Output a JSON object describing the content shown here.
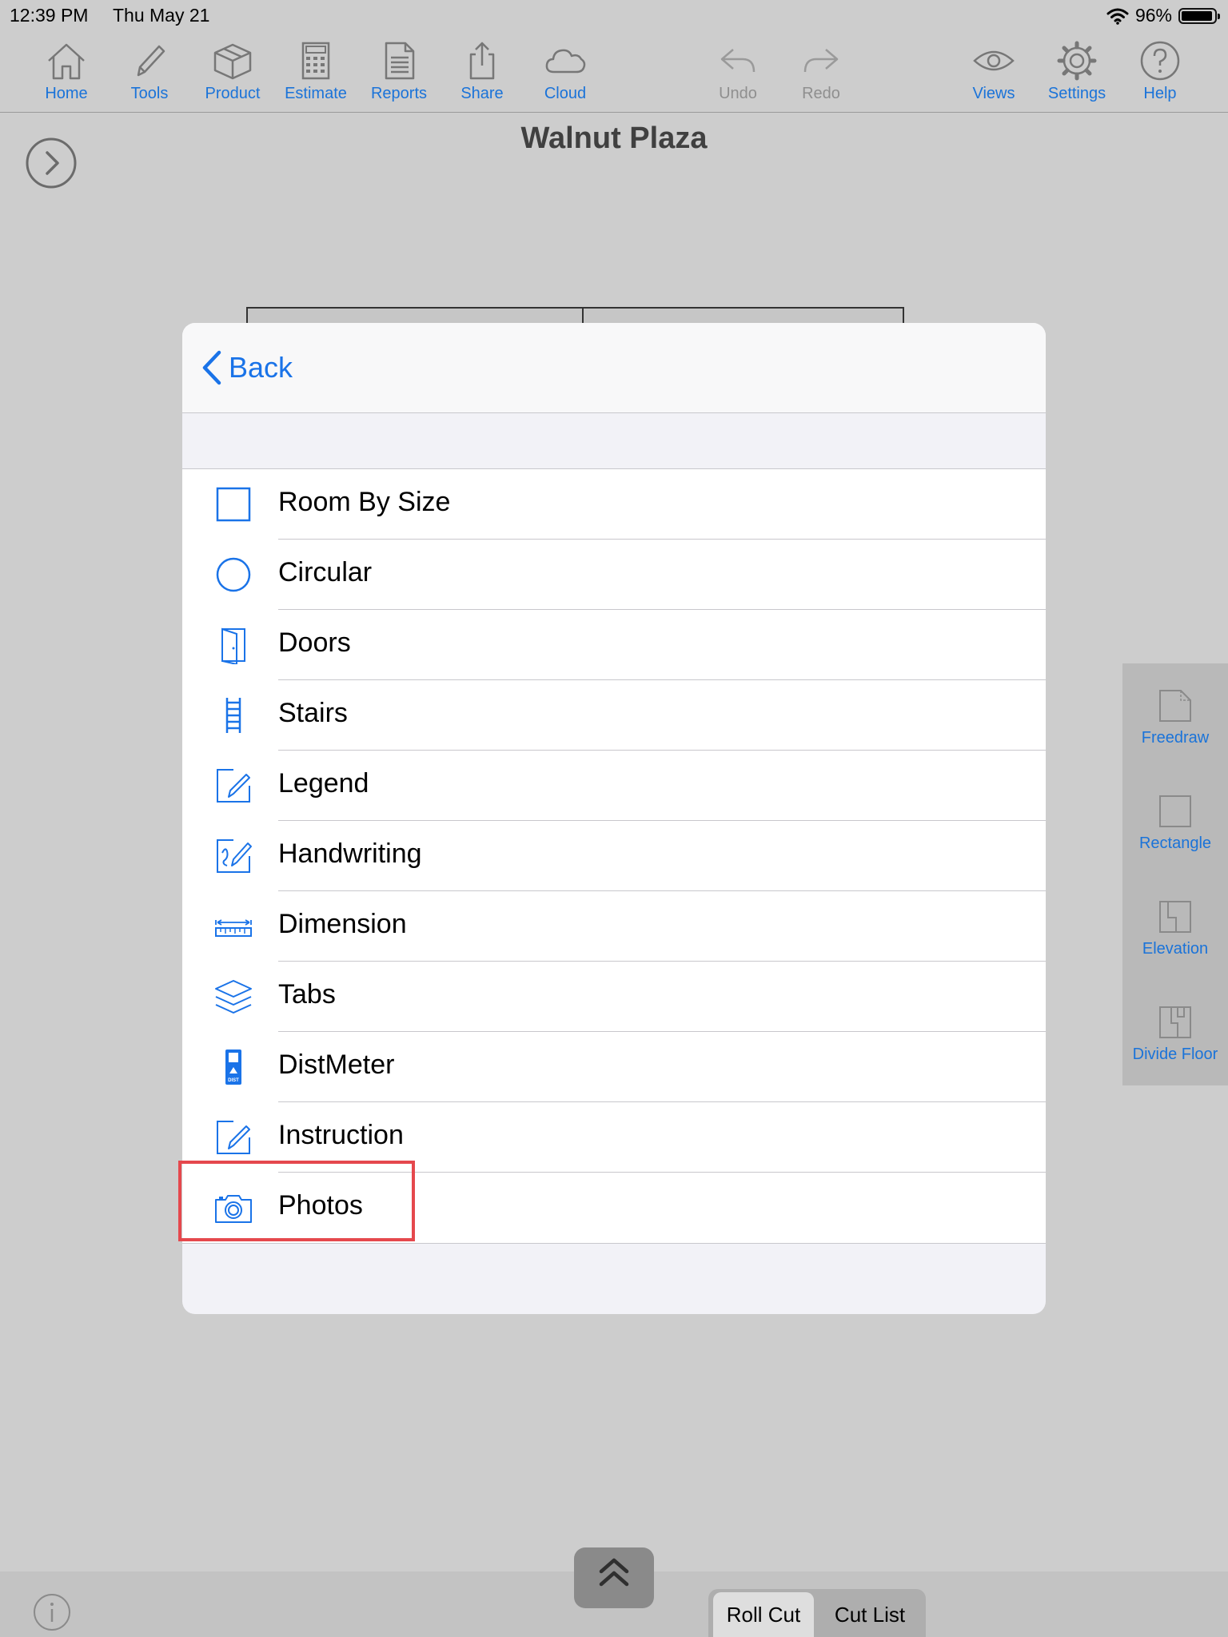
{
  "status_bar": {
    "time": "12:39 PM",
    "date": "Thu May 21",
    "battery_text": "96%",
    "battery_level": 0.96
  },
  "toolbar": {
    "home": "Home",
    "tools": "Tools",
    "product": "Product",
    "estimate": "Estimate",
    "reports": "Reports",
    "share": "Share",
    "cloud": "Cloud",
    "undo": "Undo",
    "redo": "Redo",
    "views": "Views",
    "settings": "Settings",
    "help": "Help"
  },
  "document": {
    "title": "Walnut Plaza"
  },
  "side_panel": {
    "freedraw": "Freedraw",
    "rectangle": "Rectangle",
    "elevation": "Elevation",
    "divide_floor": "Divide Floor"
  },
  "modal": {
    "back_label": "Back",
    "items": [
      {
        "label": "Room By Size",
        "icon": "square-icon"
      },
      {
        "label": "Circular",
        "icon": "circle-icon"
      },
      {
        "label": "Doors",
        "icon": "door-icon"
      },
      {
        "label": "Stairs",
        "icon": "stairs-icon"
      },
      {
        "label": "Legend",
        "icon": "legend-pencil-icon"
      },
      {
        "label": "Handwriting",
        "icon": "handwriting-icon"
      },
      {
        "label": "Dimension",
        "icon": "dimension-ruler-icon"
      },
      {
        "label": "Tabs",
        "icon": "layers-icon"
      },
      {
        "label": "DistMeter",
        "icon": "distmeter-icon",
        "icon_text": "DIST"
      },
      {
        "label": "Instruction",
        "icon": "instruction-pencil-icon"
      },
      {
        "label": "Photos",
        "icon": "camera-icon"
      }
    ]
  },
  "bottom": {
    "roll_cut": "Roll Cut",
    "cut_list": "Cut List"
  },
  "colors": {
    "accent": "#1a73d9",
    "highlight": "#e5484d",
    "disabled": "#8f8f8f"
  }
}
